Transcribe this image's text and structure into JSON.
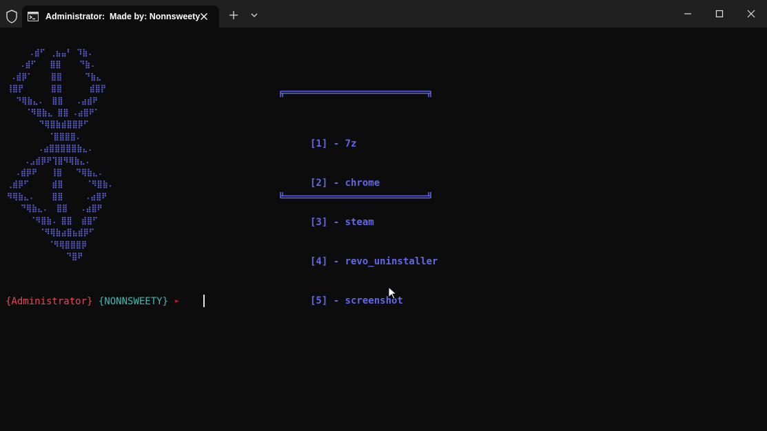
{
  "tab": {
    "title": "Administrator:  Made by: Nonnsweety"
  },
  "icons": {
    "shield": "shield-icon",
    "terminal": "terminal-icon",
    "close": "close-icon",
    "new_tab": "plus-icon",
    "dropdown": "chevron-down-icon",
    "minimize": "minimize-icon",
    "maximize": "maximize-icon",
    "window_close": "close-icon"
  },
  "colors": {
    "background": "#0c0c0c",
    "titlebar": "#202020",
    "art": "#5a5fd6",
    "menu": "#6167e8",
    "prompt_user": "#e74856",
    "prompt_host": "#3fb8b2",
    "prompt_arrow": "#e81123"
  },
  "ascii_art": "     .⣾⠋ ⢀⣦⣤⠃ ⠹⣷.\n   .⣾⠋   ⣿⣿    ⠙⣷.\n .⣾⡿⠁    ⣿⣿     ⠙⣷⣄\n⢸⣿⡟      ⣿⣿      ⣾⣿⡟\n  ⠙⢿⣷⣄.  ⣿⣿   .⣴⣾⠟\n    ⠈⠻⣿⣷⣄ ⣿⣿ .⣴⣿⠟⠁\n       ⠙⢿⣿⣷⣾⣿⣿⡿⠋\n         ⠈⣿⣿⣿⣿.\n       .⣴⣿⣿⣿⣿⣿⣷⣄.\n    .⣠⣾⡿⠟⢹⣿⠻⢿⣷⣄.\n  .⣾⡿⠟   ⢸⣿   ⠙⢿⣷⣄.\n⢀⣾⡿⠋     ⣾⣿     ⠈⠻⣿⣷.\n⠻⢿⣷⣄.    ⣿⣿     .⣴⣿⠟\n   ⠙⢿⣷⣄.  ⣿⣿   .⣴⣿⠟\n     ⠈⠻⣿⣷. ⣿⣿  ⣾⣿⠋\n       ⠈⠻⢿⣷⣴⣿⣦⣾⡿⠋\n         ⠈⠻⢿⣿⣿⣿⡿\n             ⠙⣿⠟",
  "menu": {
    "items": [
      "[1] - 7z",
      "[2] - chrome",
      "[3] - steam",
      "[4] - revo_uninstaller",
      "[5] - screenshot"
    ]
  },
  "prompt": {
    "user": "{Administrator}",
    "host": "{NONNSWEETY}",
    "arrow": "►"
  }
}
